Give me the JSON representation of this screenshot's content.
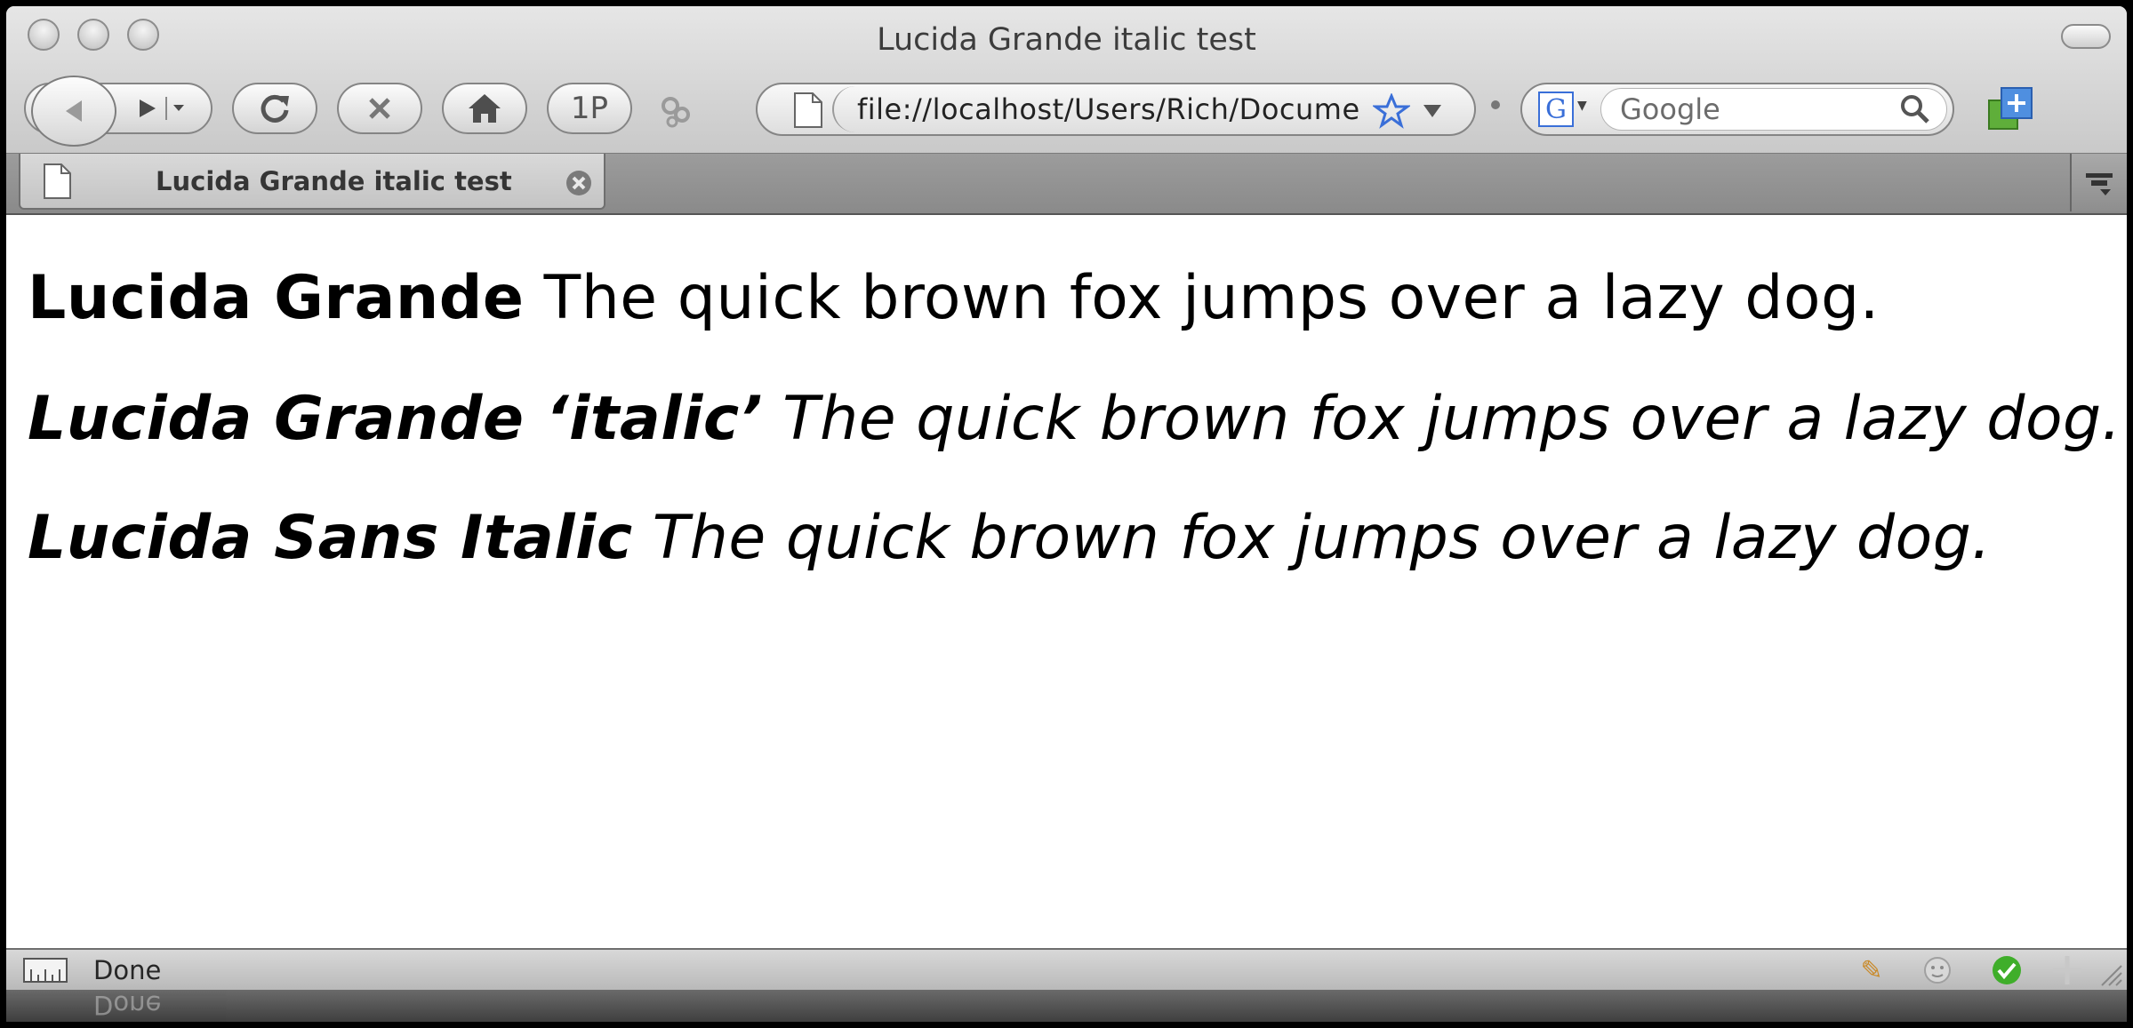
{
  "window": {
    "title": "Lucida Grande italic test"
  },
  "toolbar": {
    "back_icon": "back-arrow-icon",
    "forward_icon": "forward-arrow-icon",
    "reload_icon": "reload-icon",
    "stop_icon": "stop-icon",
    "home_icon": "home-icon",
    "onepassword_label": "1P",
    "address": {
      "value": "file://localhost/Users/Rich/Docume"
    },
    "search": {
      "placeholder": "Google",
      "engine_label": "G"
    }
  },
  "tabs": [
    {
      "label": "Lucida Grande italic test"
    }
  ],
  "content": {
    "lines": [
      {
        "font_label": "Lucida Grande",
        "sample": "The quick brown fox jumps over a lazy dog."
      },
      {
        "font_label": "Lucida Grande ‘italic’",
        "sample": "The quick brown fox jumps over a lazy dog."
      },
      {
        "font_label": "Lucida Sans Italic",
        "sample": "The quick brown fox jumps over a lazy dog."
      }
    ]
  },
  "status_bar": {
    "text": "Done"
  },
  "colors": {
    "chrome_top": "#e6e6e6",
    "chrome_bottom": "#c9c9c9",
    "star": "#3a6fd8",
    "check_green": "#3fae2a"
  }
}
